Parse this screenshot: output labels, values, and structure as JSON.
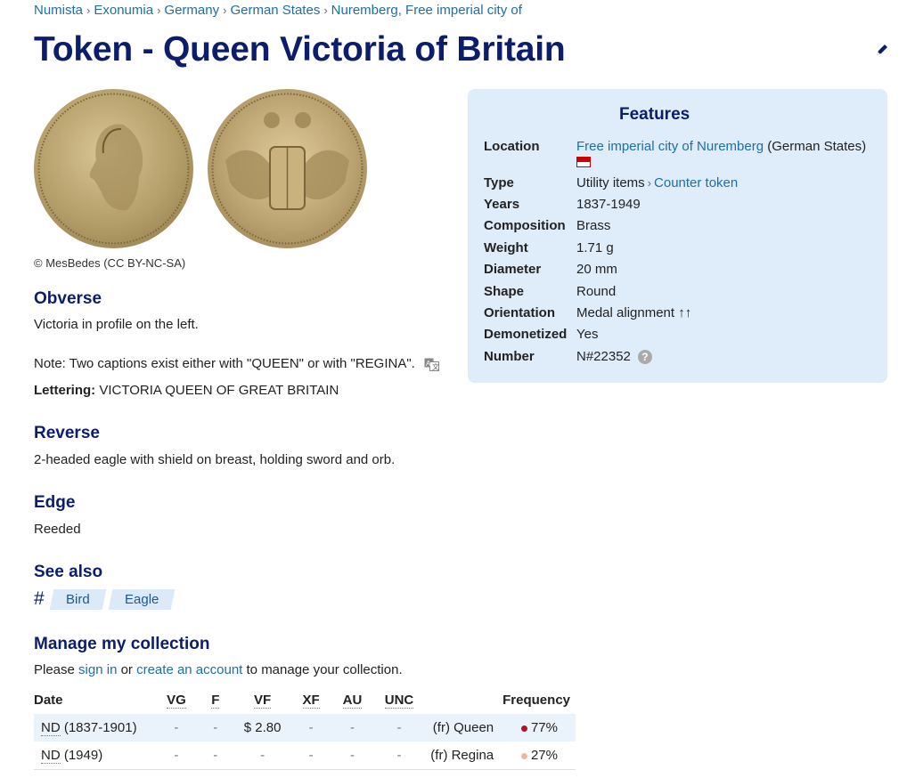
{
  "breadcrumb": [
    "Numista",
    "Exonumia",
    "Germany",
    "German States",
    "Nuremberg, Free imperial city of"
  ],
  "title": "Token - Queen Victoria of Britain",
  "image_credit": "© MesBedes (CC BY-NC-SA)",
  "obverse": {
    "heading": "Obverse",
    "description": "Victoria in profile on the left.",
    "note": "Note: Two captions exist either with \"QUEEN\" or with \"REGINA\".",
    "lettering_label": "Lettering:",
    "lettering": "VICTORIA QUEEN OF GREAT BRITAIN"
  },
  "reverse": {
    "heading": "Reverse",
    "description": "2-headed eagle with shield on breast, holding sword and orb."
  },
  "edge": {
    "heading": "Edge",
    "description": "Reeded"
  },
  "see_also": {
    "heading": "See also",
    "hash": "#",
    "tags": [
      "Bird",
      "Eagle"
    ]
  },
  "manage": {
    "heading": "Manage my collection",
    "text_1": "Please ",
    "sign_in": "sign in",
    "text_2": " or ",
    "create_account": "create an account",
    "text_3": " to manage your collection."
  },
  "features": {
    "heading": "Features",
    "location_label": "Location",
    "location_link": "Free imperial city of Nuremberg",
    "location_extra": "(German States)",
    "type_label": "Type",
    "type_value": "Utility items",
    "type_link": "Counter token",
    "years_label": "Years",
    "years_value": "1837-1949",
    "composition_label": "Composition",
    "composition_value": "Brass",
    "weight_label": "Weight",
    "weight_value": "1.71 g",
    "diameter_label": "Diameter",
    "diameter_value": "20 mm",
    "shape_label": "Shape",
    "shape_value": "Round",
    "orientation_label": "Orientation",
    "orientation_value": "Medal alignment ↑↑",
    "demonetized_label": "Demonetized",
    "demonetized_value": "Yes",
    "number_label": "Number",
    "number_value": "N#22352",
    "help_glyph": "?"
  },
  "collection_table": {
    "headers": [
      "Date",
      "VG",
      "F",
      "VF",
      "XF",
      "AU",
      "UNC",
      "",
      "Frequency"
    ],
    "rows": [
      {
        "date": "ND",
        "date_rest": " (1837-1901)",
        "vg": "-",
        "f": "-",
        "vf": "$ 2.80",
        "xf": "-",
        "au": "-",
        "unc": "-",
        "caption": "(fr) Queen",
        "frequency": "77%",
        "freq_color": "#b3121e"
      },
      {
        "date": "ND",
        "date_rest": " (1949)",
        "vg": "-",
        "f": "-",
        "vf": "-",
        "xf": "-",
        "au": "-",
        "unc": "-",
        "caption": "(fr) Regina",
        "frequency": "27%",
        "freq_color": "#f0b5a0"
      }
    ]
  },
  "colors": {
    "title": "#0b1d6b",
    "link": "#1d6fa5",
    "features_bg": "#dfecf9"
  },
  "icons": {
    "edit": "pencil-icon",
    "translate": "translate-icon",
    "help": "help-icon",
    "flag": "flag-icon"
  }
}
